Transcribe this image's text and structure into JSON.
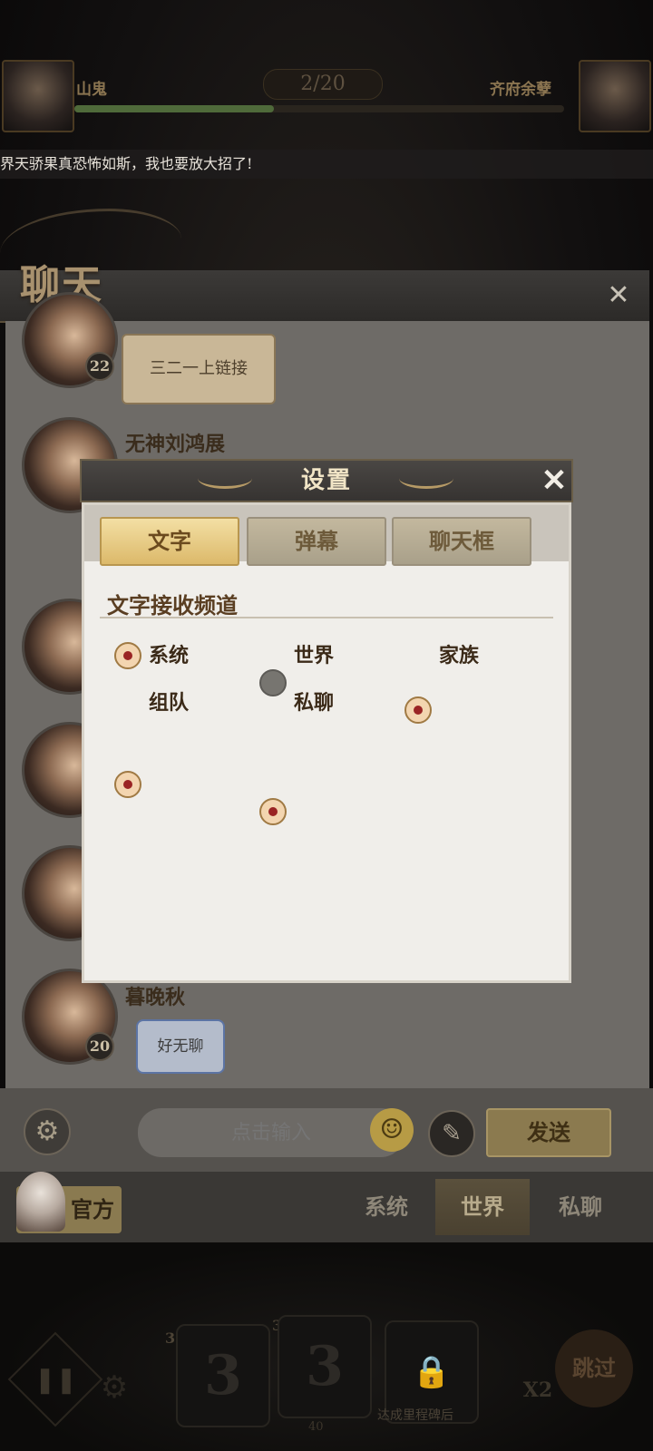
{
  "top": {
    "left_player": "山鬼",
    "right_player": "齐府余孽",
    "counter": "2/20",
    "banner": "界天骄果真恐怖如斯，我也要放大招了!"
  },
  "chat": {
    "title": "聊天",
    "messages": [
      {
        "name": "",
        "text": "三二一上链接",
        "level": "22"
      },
      {
        "name": "无神刘鸿展",
        "text": "",
        "level": ""
      },
      {
        "name": "暮晚秋",
        "text": "好无聊",
        "level": "20"
      }
    ],
    "input_placeholder": "点击输入",
    "send_label": "发送",
    "official_label": "官方",
    "channel_tabs": [
      "系统",
      "世界",
      "私聊"
    ],
    "active_tab": "世界"
  },
  "settings": {
    "title": "设置",
    "tabs": [
      "文字",
      "弹幕",
      "聊天框"
    ],
    "active_tab": "文字",
    "section_title": "文字接收频道",
    "options": [
      {
        "label": "系统",
        "checked": true
      },
      {
        "label": "世界",
        "checked": false
      },
      {
        "label": "家族",
        "checked": true
      },
      {
        "label": "组队",
        "checked": true
      },
      {
        "label": "私聊",
        "checked": true
      }
    ]
  },
  "hud": {
    "card_costs": [
      "35",
      "35"
    ],
    "card_values": [
      "3",
      "3"
    ],
    "milestone_text": "达成里程碑后",
    "skip_label": "跳过",
    "speed_label": "X2",
    "bottom_counter": "40"
  }
}
